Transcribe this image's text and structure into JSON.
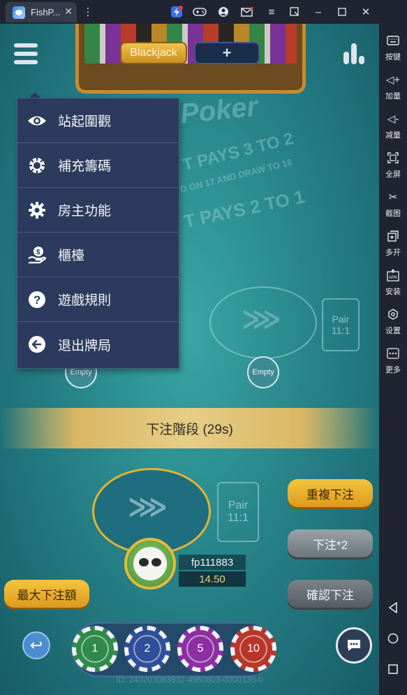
{
  "window": {
    "tab_title": "FishP...",
    "tab_close": "✕"
  },
  "sidebar": {
    "items": [
      {
        "label": "按键",
        "icon": "keyboard-icon"
      },
      {
        "label": "加量",
        "icon": "volume-up-icon"
      },
      {
        "label": "减量",
        "icon": "volume-down-icon"
      },
      {
        "label": "全屏",
        "icon": "fullscreen-icon"
      },
      {
        "label": "截图",
        "icon": "scissors-icon"
      },
      {
        "label": "多开",
        "icon": "multi-instance-icon"
      },
      {
        "label": "安装",
        "icon": "apk-install-icon"
      },
      {
        "label": "设置",
        "icon": "settings-icon"
      },
      {
        "label": "更多",
        "icon": "more-icon"
      }
    ]
  },
  "game": {
    "table_buttons": {
      "blackjack": "Blackjack",
      "add": "+"
    },
    "felt": {
      "poker": "Poker",
      "pays_line1": "T PAYS 3 TO 2",
      "pays_sub": "D ON 17 AND DRAW TO 16",
      "pays_line2": "T PAYS 2 TO 1"
    },
    "pair_right": {
      "label": "Pair",
      "odds": "11:1"
    },
    "pair_main": {
      "label": "Pair",
      "odds": "11:1"
    },
    "empty_left": "Empty",
    "empty_right": "Empty",
    "phase": "下注階段 (29s)",
    "buttons": {
      "rebet": "重複下注",
      "double_bet": "下注*2",
      "max_bet": "最大下注額",
      "confirm": "確認下注"
    },
    "player": {
      "name": "fp111883",
      "chips": "14.50"
    },
    "chips": [
      {
        "value": "1",
        "color": "#2f8a4c"
      },
      {
        "value": "2",
        "color": "#2f4f9a"
      },
      {
        "value": "5",
        "color": "#8d2fa3"
      },
      {
        "value": "10",
        "color": "#b8362a"
      }
    ],
    "table_id": "ID: 240203083832-4960803-0000135-0"
  },
  "menu": {
    "items": [
      {
        "label": "站起圍觀",
        "icon": "eye-icon"
      },
      {
        "label": "補充籌碼",
        "icon": "chip-icon"
      },
      {
        "label": "房主功能",
        "icon": "gear-icon"
      },
      {
        "label": "櫃檯",
        "icon": "money-hand-icon"
      },
      {
        "label": "遊戲規則",
        "icon": "question-icon"
      },
      {
        "label": "退出牌局",
        "icon": "exit-arrow-icon"
      }
    ]
  }
}
